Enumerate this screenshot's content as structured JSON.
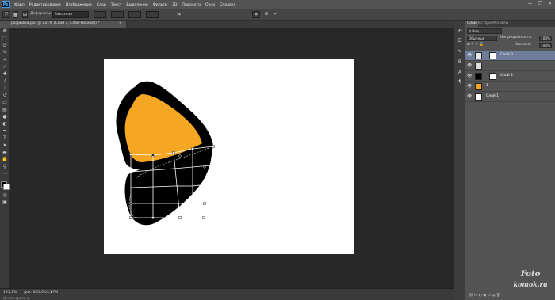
{
  "app": {
    "logo": "Ps",
    "menu": [
      "Файл",
      "Редактирование",
      "Изображение",
      "Слои",
      "Текст",
      "Выделение",
      "Фильтр",
      "3D",
      "Просмотр",
      "Окно",
      "Справка"
    ],
    "window_controls": [
      "—",
      "❐",
      "✕"
    ]
  },
  "options_bar": {
    "mode_label": "Деформация:",
    "mode_value": "Заказная",
    "commit_icons": [
      "cancel-icon",
      "commit-icon"
    ]
  },
  "document": {
    "tab_title": "разрывка.psd @ 131% (Слой 3, Слой-маска/8) *",
    "tab_close": "×"
  },
  "status": {
    "zoom": "131,1%",
    "doc_info": "Док: 861,6K/2,37M",
    "timeline_label": "Шкала времени"
  },
  "panel": {
    "tabs": [
      "Слои",
      "История",
      "Каналы"
    ],
    "blend_mode": "Обычные",
    "opacity_label": "Непрозрачность:",
    "opacity_value": "100%",
    "fill_label": "Заливка:",
    "fill_value": "100%",
    "layers": [
      {
        "name": "Слой 3",
        "selected": true,
        "has_mask": true
      },
      {
        "name": "Слой 2 копия",
        "selected": false,
        "has_mask": false
      },
      {
        "name": "Слой 2",
        "selected": false,
        "has_mask": true
      },
      {
        "name": "1",
        "selected": false,
        "has_mask": false
      },
      {
        "name": "Слой 1",
        "selected": false,
        "has_mask": false
      }
    ]
  },
  "colors": {
    "orange": "#F5A623",
    "shape": "#000000",
    "selected_layer": "#6d7c99"
  },
  "watermark": {
    "line1": "Foto",
    "line2": "komok.ru"
  }
}
